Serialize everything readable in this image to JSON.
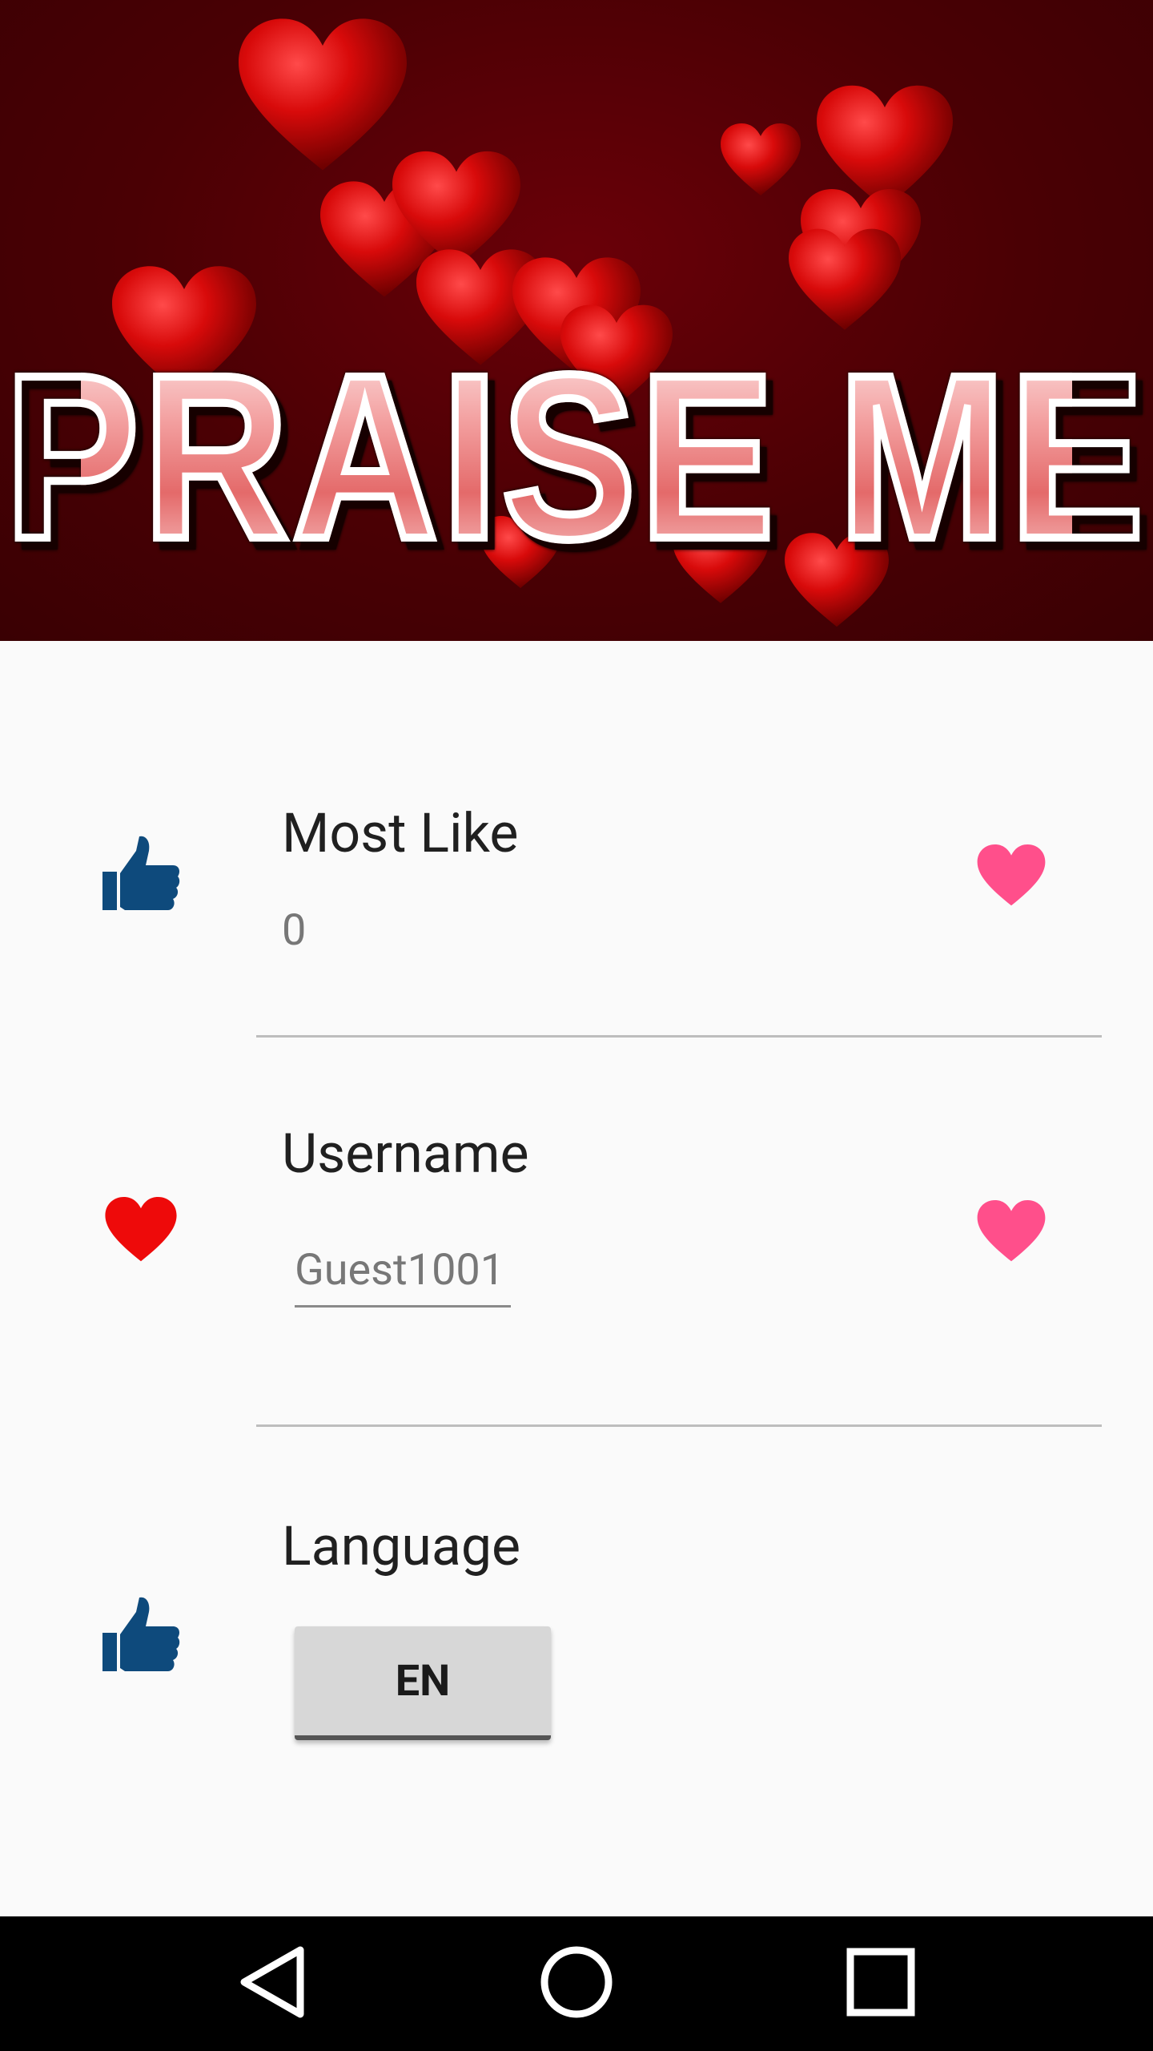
{
  "banner": {
    "title": "PRAISE ME"
  },
  "rows": {
    "most_like": {
      "label": "Most Like",
      "value": "0",
      "left_icon": "thumbs-up-icon",
      "right_icon": "heart-icon"
    },
    "username": {
      "label": "Username",
      "value": "Guest1001",
      "left_icon": "heart-icon",
      "right_icon": "heart-icon"
    },
    "language": {
      "label": "Language",
      "button_label": "EN",
      "left_icon": "thumbs-up-icon"
    }
  },
  "colors": {
    "thumb": "#0e4a7c",
    "heart_pink": "#ff4f8b",
    "heart_red": "#ee0a0a",
    "banner_bg": "#4a0004"
  },
  "navbar": {
    "back_icon": "back-triangle-icon",
    "home_icon": "home-circle-icon",
    "recents_icon": "recents-square-icon"
  }
}
